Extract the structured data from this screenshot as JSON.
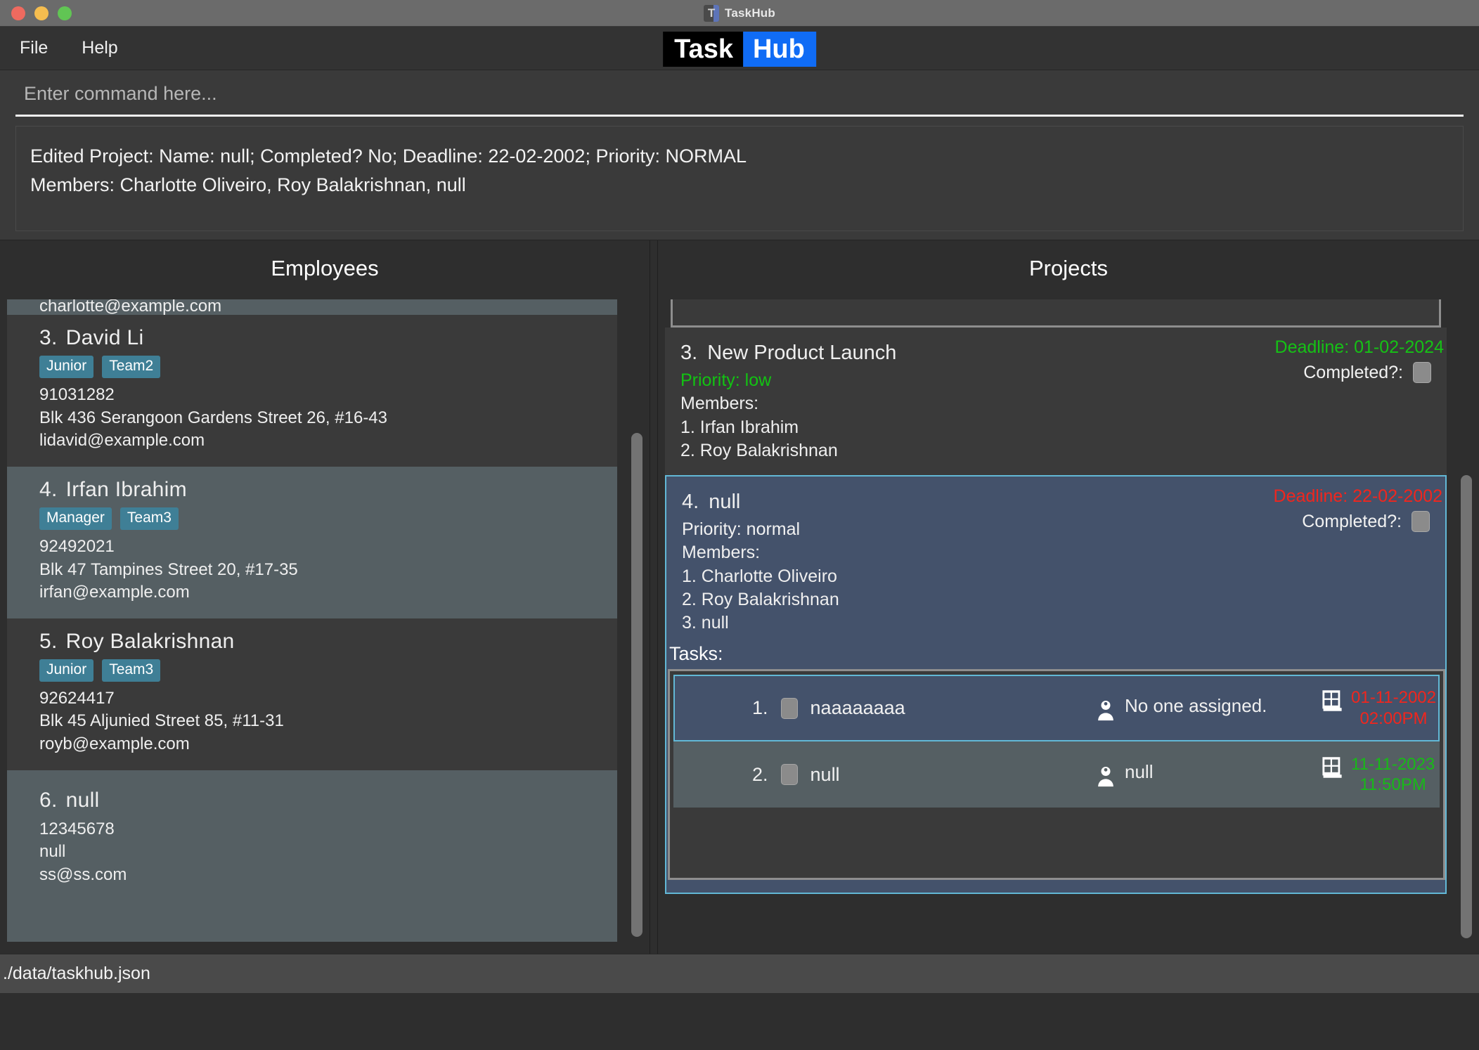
{
  "window": {
    "title": "TaskHub",
    "logo_letter": "T",
    "traffic_lights": [
      "close",
      "minimize",
      "zoom"
    ]
  },
  "menubar": {
    "items": [
      {
        "label": "File"
      },
      {
        "label": "Help"
      }
    ],
    "brand": {
      "part1": "Task",
      "part2": "Hub"
    }
  },
  "command": {
    "placeholder": "Enter command here...",
    "value": ""
  },
  "console": {
    "lines": [
      "Edited Project: Name: null; Completed? No; Deadline: 22-02-2002; Priority: NORMAL",
      "Members: Charlotte Oliveiro, Roy Balakrishnan, null"
    ]
  },
  "employees_panel": {
    "title": "Employees",
    "clipped_top_line": "charlotte@example.com",
    "items": [
      {
        "index": "3.",
        "name": "David Li",
        "tags": [
          "Junior",
          "Team2"
        ],
        "phone": "91031282",
        "address": "Blk 436 Serangoon Gardens Street 26, #16-43",
        "email": "lidavid@example.com"
      },
      {
        "index": "4.",
        "name": "Irfan Ibrahim",
        "tags": [
          "Manager",
          "Team3"
        ],
        "phone": "92492021",
        "address": "Blk 47 Tampines Street 20, #17-35",
        "email": "irfan@example.com"
      },
      {
        "index": "5.",
        "name": "Roy Balakrishnan",
        "tags": [
          "Junior",
          "Team3"
        ],
        "phone": "92624417",
        "address": "Blk 45 Aljunied Street 85, #11-31",
        "email": "royb@example.com"
      },
      {
        "index": "6.",
        "name": "null",
        "tags": [],
        "phone": "12345678",
        "address": "null",
        "email": "ss@ss.com"
      }
    ]
  },
  "projects_panel": {
    "title": "Projects",
    "completed_label": "Completed?:",
    "members_label": "Members:",
    "tasks_label": "Tasks:",
    "items": [
      {
        "index": "3.",
        "name": "New Product Launch",
        "priority_text": "Priority: low",
        "priority_level": "low",
        "deadline": "Deadline: 01-02-2024",
        "deadline_state": "green",
        "completed": false,
        "members": [
          "1. Irfan Ibrahim",
          "2. Roy Balakrishnan"
        ],
        "selected": false
      },
      {
        "index": "4.",
        "name": "null",
        "priority_text": "Priority: normal",
        "priority_level": "normal",
        "deadline": "Deadline: 22-02-2002",
        "deadline_state": "red",
        "completed": false,
        "members": [
          "1. Charlotte Oliveiro",
          "2. Roy Balakrishnan",
          "3. null"
        ],
        "selected": true,
        "tasks": [
          {
            "index": "1.",
            "title": "naaaaaaaa",
            "done": false,
            "assignee": "No one assigned.",
            "date": "01-11-2002",
            "time": "02:00PM",
            "date_state": "red",
            "selected": true
          },
          {
            "index": "2.",
            "title": "null",
            "done": false,
            "assignee": "null",
            "date": "11-11-2023",
            "time": "11:50PM",
            "date_state": "green",
            "selected": false
          }
        ]
      }
    ]
  },
  "statusbar": {
    "path": "./data/taskhub.json"
  },
  "colors": {
    "accent_blue": "#106cf5",
    "tag_blue": "#3f7f96",
    "selected_card": "#44526b",
    "selected_border": "#62b8d6",
    "deadline_green": "#15c215",
    "deadline_red": "#f0261e",
    "priority_low": "#12c312"
  }
}
